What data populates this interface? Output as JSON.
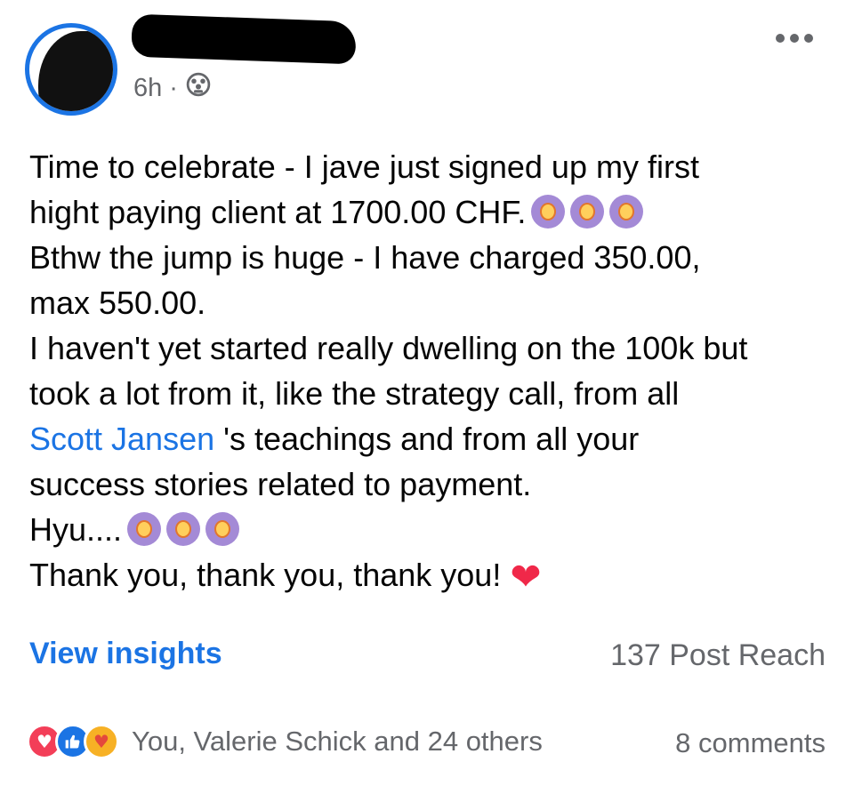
{
  "post": {
    "author_time": "6h",
    "separator": "·",
    "audience_icon": "friends-icon",
    "more_icon": "more-options-icon",
    "lines": {
      "l1": "Time to celebrate - I jave just signed up my first",
      "l2": "hight paying client at 1700.00 CHF.",
      "l3": "Bthw the jump is huge - I have charged 350.00,",
      "l4": "max 550.00.",
      "l5": "I haven't yet started really dwelling on the 100k but",
      "l6": "took a lot from it, like the strategy call, from all",
      "mention": "Scott Jansen",
      "l7_rest": " 's teachings and from all your",
      "l8": "success stories related to payment.",
      "l9": "Hyu....",
      "l10": "Thank you, thank you, thank you!"
    },
    "emoji_name": "person-gesturing-ok-emoji",
    "heart": "❤"
  },
  "footer": {
    "insights_label": "View insights",
    "reach_label": "137 Post Reach",
    "reactors_text": "You, Valerie Schick and 24 others",
    "comments_text": "8 comments",
    "reaction_icons": [
      "love-reaction-icon",
      "like-reaction-icon",
      "care-reaction-icon"
    ]
  },
  "colors": {
    "link": "#1b74e4",
    "secondary_text": "#65676b",
    "heart": "#f02849"
  }
}
